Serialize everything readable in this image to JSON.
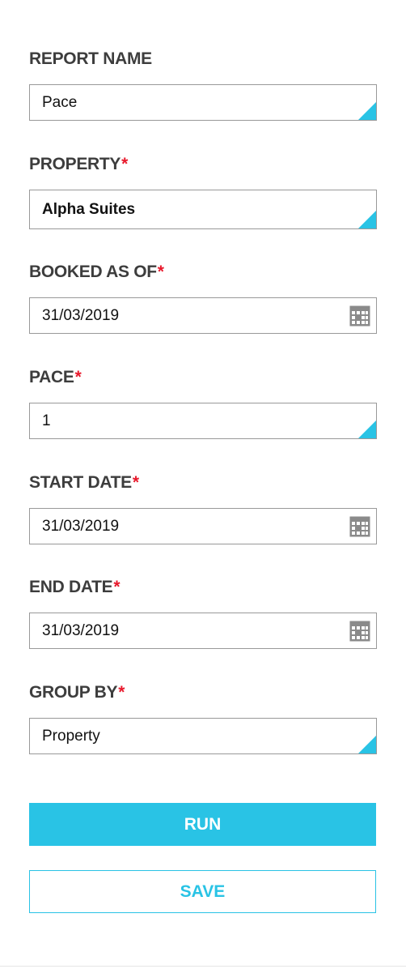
{
  "form": {
    "report_name": {
      "label": "REPORT NAME",
      "value": "Pace"
    },
    "property": {
      "label": "PROPERTY",
      "required_mark": "*",
      "value": "Alpha Suites"
    },
    "booked_as_of": {
      "label": "BOOKED AS OF",
      "required_mark": "*",
      "value": "31/03/2019",
      "icon": "calendar-icon"
    },
    "pace": {
      "label": "PACE",
      "required_mark": "*",
      "value": "1"
    },
    "start_date": {
      "label": "START DATE",
      "required_mark": "*",
      "value": "31/03/2019",
      "icon": "calendar-icon"
    },
    "end_date": {
      "label": "END DATE",
      "required_mark": "*",
      "value": "31/03/2019",
      "icon": "calendar-icon"
    },
    "group_by": {
      "label": "GROUP BY",
      "required_mark": "*",
      "value": "Property"
    }
  },
  "actions": {
    "run_label": "RUN",
    "save_label": "SAVE"
  },
  "colors": {
    "accent": "#29c3e5",
    "required": "#e8192c",
    "label": "#3d3d3d",
    "border": "#999999"
  }
}
